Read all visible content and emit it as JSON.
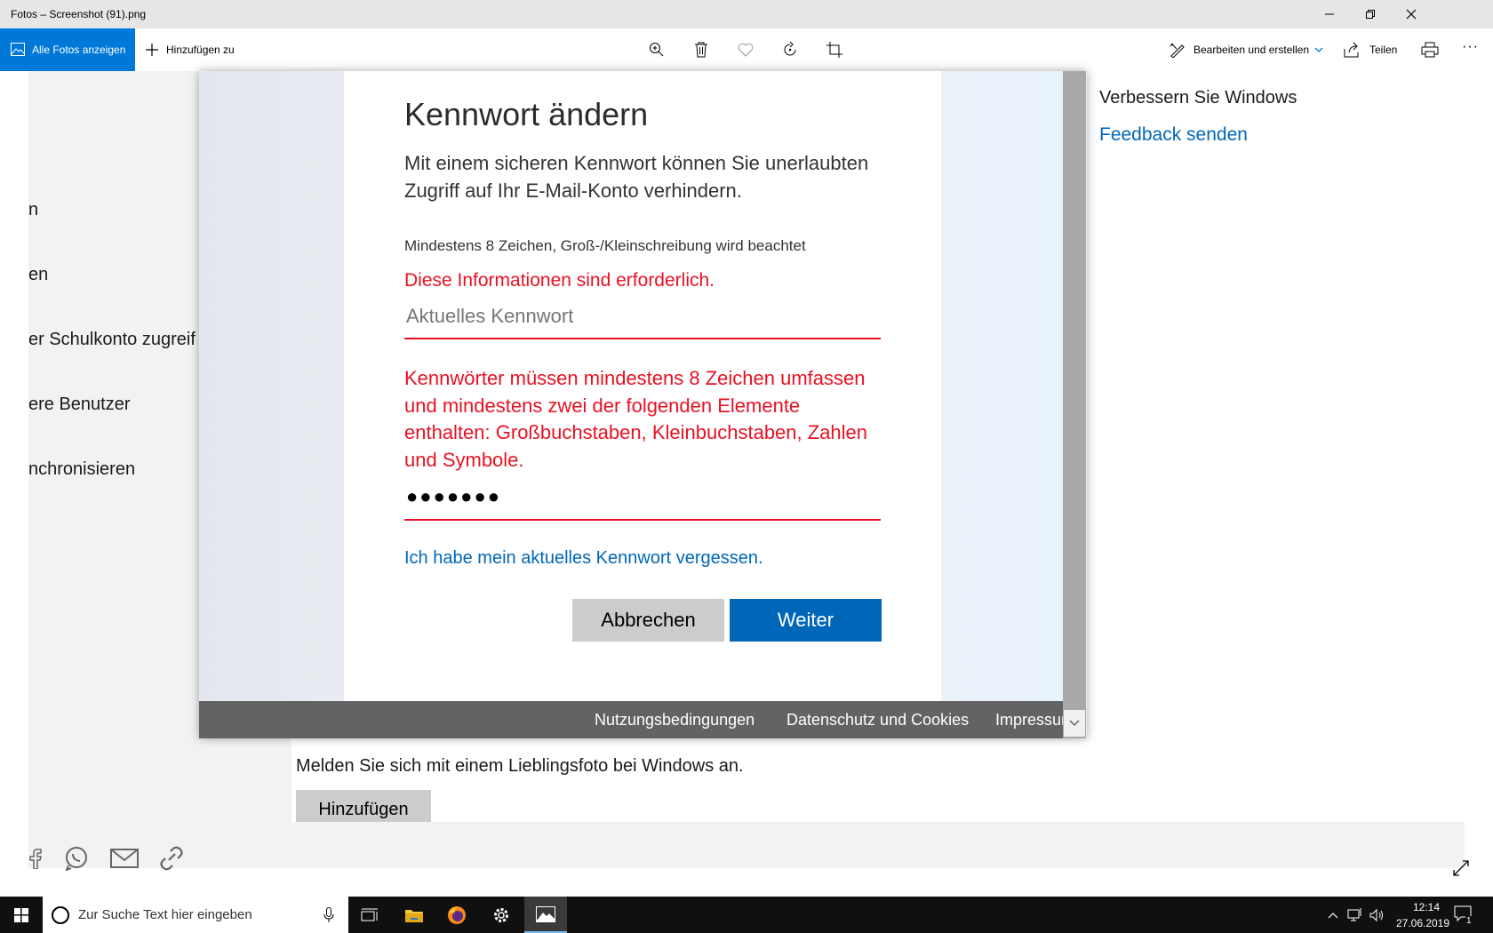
{
  "window": {
    "title": "Fotos – Screenshot (91).png"
  },
  "toolbar": {
    "all_photos_label": "Alle Fotos anzeigen",
    "add_to_label": "Hinzufügen zu",
    "edit_create_label": "Bearbeiten und erstellen",
    "share_label": "Teilen",
    "more_label": "···"
  },
  "settings_bg": {
    "sidebar_items": [
      "n",
      "en",
      "er Schulkonto zugreif",
      "ere Benutzer",
      "nchronisieren"
    ],
    "right_heading": "Verbessern Sie Windows",
    "right_link": "Feedback senden",
    "melden_text": "Melden Sie sich mit einem Lieblingsfoto bei Windows an.",
    "hinzufuegen_button": "Hinzufügen"
  },
  "dialog": {
    "title": "Kennwort ändern",
    "intro": "Mit einem sicheren Kennwort können Sie unerlaubten Zugriff auf Ihr E-Mail-Konto verhindern.",
    "hint": "Mindestens 8 Zeichen, Groß-/Kleinschreibung wird beachtet",
    "required_error": "Diese Informationen sind erforderlich.",
    "current_password_placeholder": "Aktuelles Kennwort",
    "password_rule_error": "Kennwörter müssen mindestens 8 Zeichen umfassen und mindestens zwei der folgenden Elemente enthalten: Großbuchstaben, Kleinbuchstaben, Zahlen und Symbole.",
    "new_password_masked": "●●●●●●●",
    "forgot_link": "Ich habe mein aktuelles Kennwort vergessen.",
    "cancel_button": "Abbrechen",
    "next_button": "Weiter",
    "footer_links": [
      "Nutzungsbedingungen",
      "Datenschutz und Cookies",
      "Impressum"
    ]
  },
  "taskbar": {
    "search_placeholder": "Zur Suche Text hier eingeben",
    "time": "12:14",
    "date": "27.06.2019",
    "notification_count": "1"
  },
  "colors": {
    "accent": "#0078d7",
    "link": "#0067b8",
    "error": "#e81123",
    "taskbar": "#101010"
  }
}
